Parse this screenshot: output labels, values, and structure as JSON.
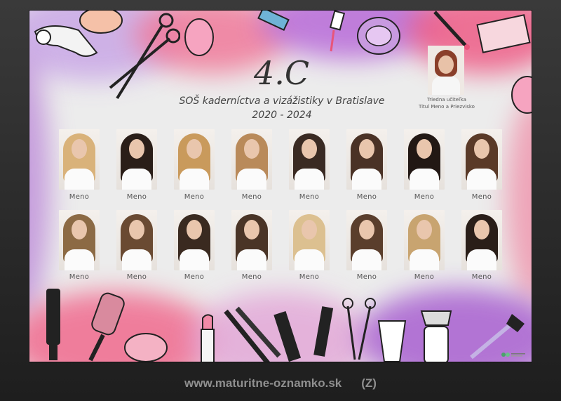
{
  "poster": {
    "class_label": "4.C",
    "school_name": "SOŠ kaderníctva a vizážistiky v Bratislave",
    "years": "2020 - 2024",
    "teacher": {
      "line1": "Triedna učiteľka",
      "line2": "Titul Meno a Priezvisko"
    },
    "students_row1": [
      {
        "name": "Meno",
        "hair": "#d9b27a"
      },
      {
        "name": "Meno",
        "hair": "#2a1e18"
      },
      {
        "name": "Meno",
        "hair": "#c99a5c"
      },
      {
        "name": "Meno",
        "hair": "#b98a5a"
      },
      {
        "name": "Meno",
        "hair": "#3a2a22"
      },
      {
        "name": "Meno",
        "hair": "#4a3226"
      },
      {
        "name": "Meno",
        "hair": "#221814"
      },
      {
        "name": "Meno",
        "hair": "#5a3a28"
      }
    ],
    "students_row2": [
      {
        "name": "Meno",
        "hair": "#8c6a44"
      },
      {
        "name": "Meno",
        "hair": "#6a4a32"
      },
      {
        "name": "Meno",
        "hair": "#3a2a20"
      },
      {
        "name": "Meno",
        "hair": "#4a3426"
      },
      {
        "name": "Meno",
        "hair": "#dcc090"
      },
      {
        "name": "Meno",
        "hair": "#5a3e2c"
      },
      {
        "name": "Meno",
        "hair": "#c8a470"
      },
      {
        "name": "Meno",
        "hair": "#2a1e18"
      }
    ],
    "colors": {
      "pink": "#e8557a",
      "purple": "#9a4fc4",
      "background": "#ececec"
    },
    "decor_icons": [
      "hair-dryer-icon",
      "scissors-icon",
      "makeup-sponge-icon",
      "lipstick-icon",
      "eyeshadow-palette-icon",
      "nail-polish-icon",
      "compact-powder-icon",
      "comb-icon",
      "round-brush-icon",
      "hair-straightener-icon",
      "spray-bottle-icon",
      "clipper-icon"
    ]
  },
  "footer": {
    "url": "www.maturitne-oznamko.sk",
    "code": "(Z)"
  }
}
